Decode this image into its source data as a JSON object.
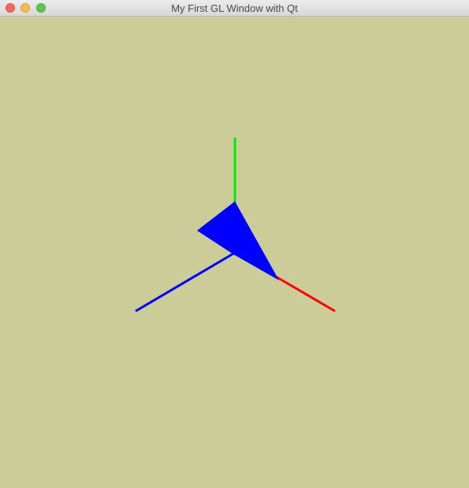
{
  "window": {
    "title": "My First GL Window with Qt",
    "background_color": "#cccc99"
  },
  "titlebar": {
    "buttons": [
      "close",
      "minimize",
      "zoom"
    ]
  },
  "scene": {
    "axes": [
      {
        "name": "x-axis",
        "color": "#ff0000"
      },
      {
        "name": "y-axis",
        "color": "#00ee00"
      },
      {
        "name": "z-axis",
        "color": "#0000ff"
      }
    ],
    "triangle": {
      "color": "#0000ff"
    }
  }
}
